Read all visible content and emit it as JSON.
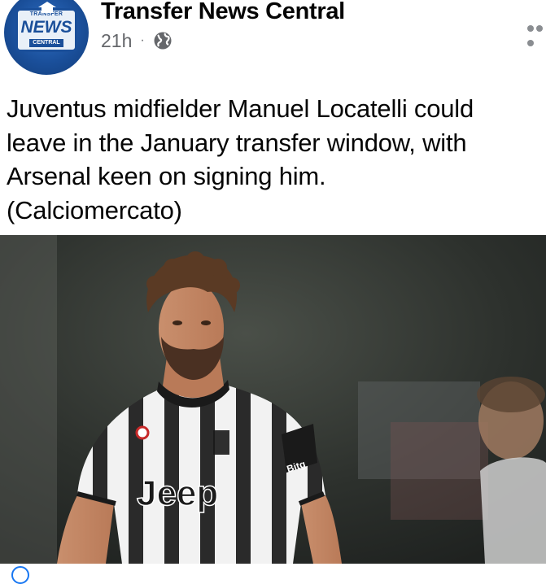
{
  "post": {
    "author": {
      "name": "Transfer News Central",
      "avatar_top_text": "TRANSFER",
      "avatar_main_text": "NEWS",
      "avatar_sub_text": "CENTRAL"
    },
    "timestamp": "21h",
    "separator": "·",
    "audience_icon": "globe-icon",
    "more_icon": "more-options-icon",
    "text_lines": [
      "Juventus midfielder Manuel Locatelli could",
      "leave in the January transfer window, with",
      "Arsenal keen on signing him.",
      "(Calciomercato)"
    ],
    "photo": {
      "jersey_sponsor": "Jeep",
      "jersey_sleeve_sponsor": "Bitg"
    }
  },
  "colors": {
    "text_primary": "#050505",
    "text_secondary": "#65676b",
    "brand_blue": "#1a4f9a"
  }
}
